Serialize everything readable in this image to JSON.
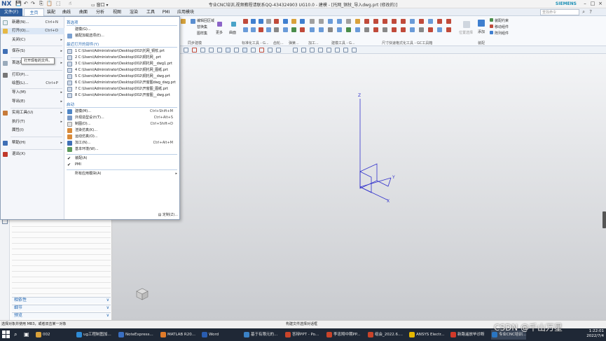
{
  "titlebar": {
    "logo": "NX",
    "title": "专业CNC培训,视频教程请联系QQ-434324903 UG10.0 - 建模 - [托网_铜杖_导入dwg.prt   (修改的)]",
    "brand": "SIEMENS",
    "window_label": "窗口",
    "min": "–",
    "max": "□",
    "close": "×"
  },
  "menubar": {
    "file": "文件(F)",
    "tabs": [
      "主页",
      "装配",
      "曲线",
      "曲面",
      "分析",
      "视图",
      "渲染",
      "工具",
      "PMI",
      "应用模块"
    ],
    "search_placeholder": "查找命令"
  },
  "ribbon": {
    "items_right": [
      "编辑回区域",
      "替换集",
      "图样集",
      "更多",
      "曲面",
      "更多"
    ],
    "group_labels": [
      "同步建模",
      "标准化工具 - G...",
      "齿轮...",
      "弹簧...",
      "加工...",
      "建模工具 - G...",
      "尺寸快速格式化工具 - GC工具箱",
      "装配"
    ],
    "assembly_items": [
      "装配约束",
      "移动组件",
      "阵列组件"
    ],
    "add_label": "添加",
    "selector_label": "位置选择"
  },
  "file_menu": {
    "left_items": [
      {
        "label": "新建(N)...",
        "shortcut": "Ctrl+N",
        "arrow": ""
      },
      {
        "label": "打开(O)...",
        "shortcut": "Ctrl+O",
        "arrow": ""
      },
      {
        "label": "关闭(C)",
        "shortcut": "",
        "arrow": "▸"
      },
      {
        "label": "保存(S)",
        "shortcut": "",
        "arrow": "▸"
      },
      {
        "label": "首选项(P)",
        "shortcut": "",
        "arrow": "▸"
      },
      {
        "label": "打印(P)...",
        "shortcut": "",
        "arrow": ""
      },
      {
        "label": "绘图(L)...",
        "shortcut": "Ctrl+P",
        "arrow": ""
      },
      {
        "label": "导入(M)",
        "shortcut": "",
        "arrow": "▸"
      },
      {
        "label": "导出(E)",
        "shortcut": "",
        "arrow": "▸"
      },
      {
        "label": "实用工具(U)",
        "shortcut": "",
        "arrow": "▸"
      },
      {
        "label": "执行(T)",
        "shortcut": "",
        "arrow": "▸"
      },
      {
        "label": "属性(I)",
        "shortcut": "",
        "arrow": ""
      },
      {
        "label": "帮助(H)",
        "shortcut": "",
        "arrow": "▸"
      },
      {
        "label": "退出(X)",
        "shortcut": "",
        "arrow": ""
      }
    ],
    "tooltip": "打开现有的文件。",
    "sections": {
      "preferences": "首选项",
      "recent": "最近打开的部件(Y)",
      "launch": "启动"
    },
    "preference_items": [
      "建模(G)...",
      "装配加载选项(E)..."
    ],
    "recent_files": [
      "1 C:\\Users\\Administrator\\Desktop\\002\\托网_铜杖.prt",
      "2 C:\\Users\\Administrator\\Desktop\\002\\铜托网_.prt",
      "3 C:\\Users\\Administrator\\Desktop\\002\\铜托网__dwg1.prt",
      "4 C:\\Users\\Administrator\\Desktop\\002\\铜托网_图纸.prt",
      "5 C:\\Users\\Administrator\\Desktop\\002\\铜托网__dwg.prt",
      "6 C:\\Users\\Administrator\\Desktop\\002\\开窗图dwg_dwg.prt",
      "7 C:\\Users\\Administrator\\Desktop\\002\\开窗图_图纸.prt",
      "8 C:\\Users\\Administrator\\Desktop\\002\\开窗图__dwg.prt"
    ],
    "launch_items": [
      {
        "label": "建模(M)...",
        "shortcut": "Ctrl+Shift+M"
      },
      {
        "label": "外观造型设计(T)...",
        "shortcut": "Ctrl+Alt+S"
      },
      {
        "label": "制图(D)...",
        "shortcut": "Ctrl+Shift+D"
      },
      {
        "label": "渲染仿真(K)...",
        "shortcut": ""
      },
      {
        "label": "运动仿真(O)...",
        "shortcut": ""
      },
      {
        "label": "加工(N)...",
        "shortcut": "Ctrl+Alt+M"
      },
      {
        "label": "基本环境(W)...",
        "shortcut": ""
      }
    ],
    "checked_items": [
      "装配(A)",
      "PMI"
    ],
    "all_apps": "所有应用模块(A)",
    "customize": "定制(Z)..."
  },
  "nav_panel": {
    "accordions": [
      "相依性",
      "细节",
      "预览"
    ]
  },
  "viewport": {
    "axis_x": "X",
    "axis_y": "Y",
    "axis_z": "Z"
  },
  "statusbar": {
    "left": "选择对象并使用 MB3，或者双击某一对象",
    "center": "构建文件选择对话框"
  },
  "taskbar": {
    "items": [
      "002",
      "ug工程制图加...",
      "NoteExpress...",
      "MATLAB R20...",
      "Word",
      "基于有限元的...",
      "答辩PPT - Po...",
      "李忠翔中期PP...",
      "组会_2022.6....",
      "ANSYS Electr...",
      "新路遥放毕诊断",
      "专业CNC培训..."
    ],
    "colors": [
      "#d9a13a",
      "#2e8bd6",
      "#3a6fc2",
      "#e07b2a",
      "#2a5db0",
      "#3b82c6",
      "#c9442a",
      "#c9442a",
      "#c9442a",
      "#e6b800",
      "#d23a2a",
      "#2a76c2"
    ],
    "time": "1:22:01",
    "date": "2022/7/4"
  },
  "watermark": "CSDN @千山万星",
  "colors": {
    "accent": "#1f64b0",
    "file_tab": "#2e5e9e",
    "axis": "#3333cc"
  }
}
